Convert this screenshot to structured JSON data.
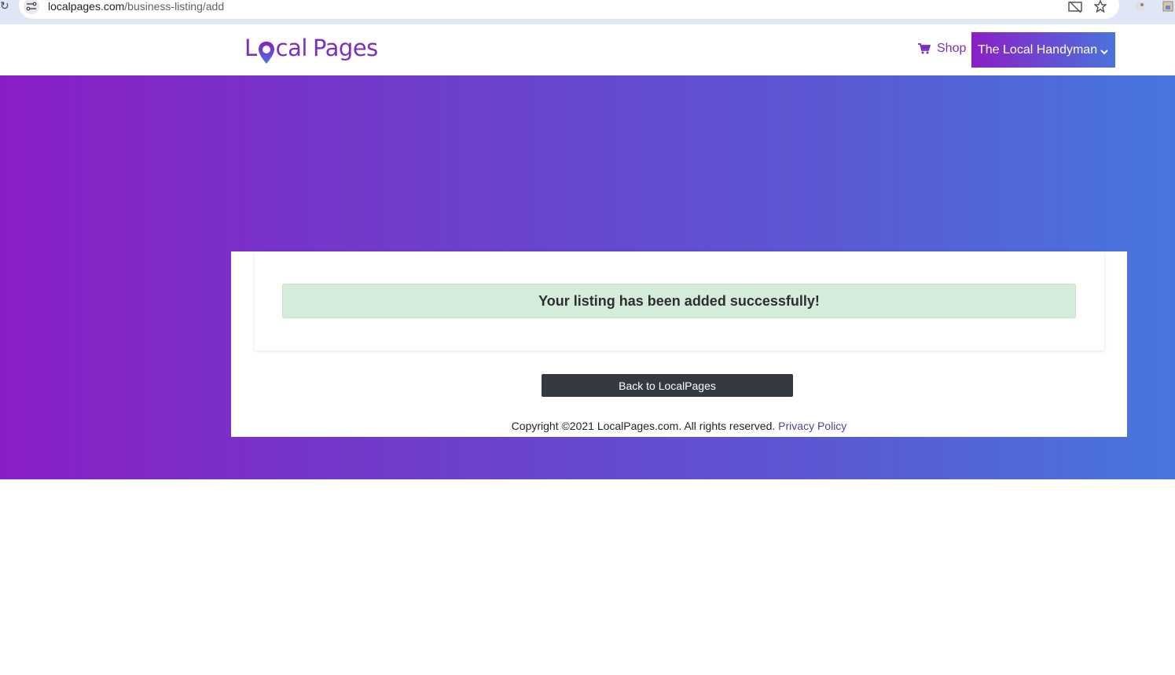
{
  "browser": {
    "url_host": "localpages.com",
    "url_path": "/business-listing/add"
  },
  "header": {
    "logo_text_l": "L",
    "logo_text_rest": "cal",
    "logo_text_pages": "Pages",
    "shop_label": "Shop",
    "user_menu_label": "The Local Handyman"
  },
  "alert": {
    "message": "Your listing has been added successfully!"
  },
  "actions": {
    "back_label": "Back to LocalPages"
  },
  "footer": {
    "copyright": "Copyright ©2021 LocalPages.com. All rights reserved.",
    "privacy_label": "Privacy Policy"
  },
  "colors": {
    "brand_purple": "#7b2fbe",
    "gradient_start": "#8a1ec5",
    "gradient_end": "#4876dc",
    "success_bg": "#d4ecda",
    "button_dark": "#343a40"
  }
}
